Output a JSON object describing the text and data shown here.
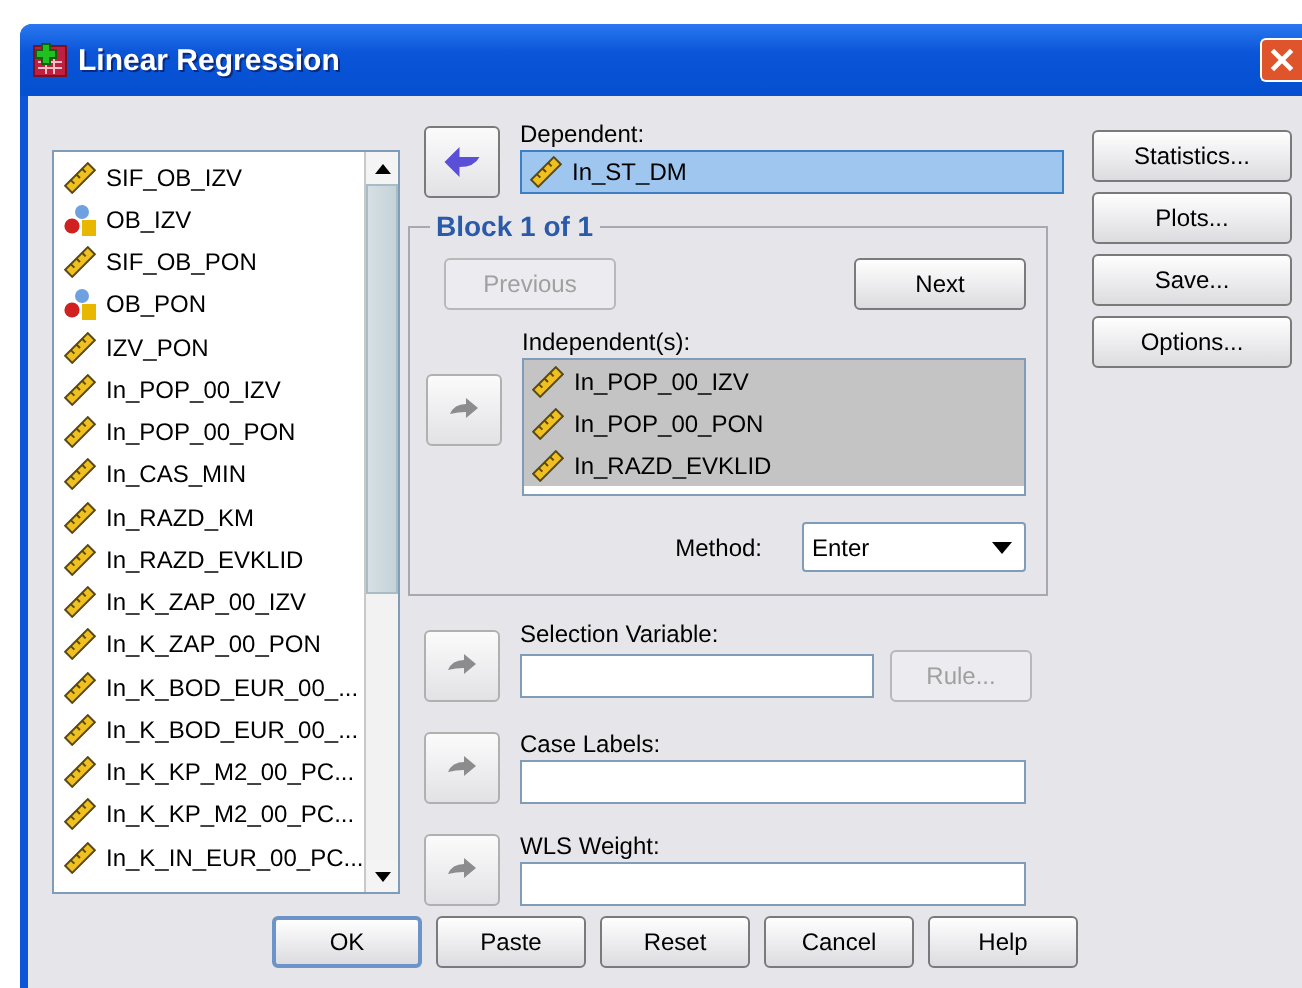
{
  "window": {
    "title": "Linear Regression"
  },
  "variables": [
    {
      "name": "SIF_OB_IZV",
      "kind": "scale"
    },
    {
      "name": "OB_IZV",
      "kind": "nominal"
    },
    {
      "name": "SIF_OB_PON",
      "kind": "scale"
    },
    {
      "name": "OB_PON",
      "kind": "nominal"
    },
    {
      "name": "IZV_PON",
      "kind": "scale"
    },
    {
      "name": "In_POP_00_IZV",
      "kind": "scale"
    },
    {
      "name": "In_POP_00_PON",
      "kind": "scale"
    },
    {
      "name": "In_CAS_MIN",
      "kind": "scale"
    },
    {
      "name": "In_RAZD_KM",
      "kind": "scale"
    },
    {
      "name": "In_RAZD_EVKLID",
      "kind": "scale"
    },
    {
      "name": "In_K_ZAP_00_IZV",
      "kind": "scale"
    },
    {
      "name": "In_K_ZAP_00_PON",
      "kind": "scale"
    },
    {
      "name": "In_K_BOD_EUR_00_...",
      "kind": "scale"
    },
    {
      "name": "In_K_BOD_EUR_00_...",
      "kind": "scale"
    },
    {
      "name": "In_K_KP_M2_00_PC...",
      "kind": "scale"
    },
    {
      "name": "In_K_KP_M2_00_PC...",
      "kind": "scale"
    },
    {
      "name": "In_K_IN_EUR_00_PC...",
      "kind": "scale"
    }
  ],
  "dependent": {
    "label": "Dependent:",
    "move_disabled": false,
    "value": {
      "name": "In_ST_DM",
      "kind": "scale",
      "selected": true
    }
  },
  "block": {
    "title": "Block 1 of 1",
    "previous": {
      "label": "Previous",
      "disabled": true
    },
    "next": {
      "label": "Next",
      "disabled": false
    },
    "independents_label": "Independent(s):",
    "move_disabled": true,
    "independents": [
      {
        "name": "In_POP_00_IZV",
        "kind": "scale",
        "selected": true
      },
      {
        "name": "In_POP_00_PON",
        "kind": "scale",
        "selected": true
      },
      {
        "name": "In_RAZD_EVKLID",
        "kind": "scale",
        "selected": true
      }
    ],
    "method": {
      "label": "Method:",
      "value": "Enter"
    }
  },
  "selection_variable": {
    "label": "Selection Variable:",
    "move_disabled": true,
    "rule": {
      "label": "Rule...",
      "disabled": true
    }
  },
  "case_labels": {
    "label": "Case Labels:",
    "move_disabled": true
  },
  "wls_weight": {
    "label": "WLS Weight:",
    "move_disabled": true
  },
  "side_buttons": [
    {
      "label": "Statistics..."
    },
    {
      "label": "Plots..."
    },
    {
      "label": "Save..."
    },
    {
      "label": "Options..."
    }
  ],
  "buttons": [
    {
      "label": "OK",
      "default": true
    },
    {
      "label": "Paste",
      "default": false
    },
    {
      "label": "Reset",
      "default": false
    },
    {
      "label": "Cancel",
      "default": false
    },
    {
      "label": "Help",
      "default": false
    }
  ]
}
